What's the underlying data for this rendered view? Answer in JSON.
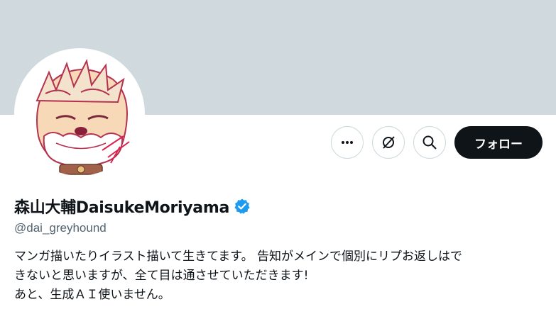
{
  "profile": {
    "display_name": "森山大輔DaisukeMoriyama",
    "handle": "@dai_greyhound",
    "verified": true,
    "bio_lines": [
      "マンガ描いたりイラスト描いて生きてます。 告知がメインで個別にリプお返しはで",
      "きないと思いますが、全て目は通させていただきます!",
      "あと、生成ＡＩ使いません。"
    ]
  },
  "actions": {
    "more_icon": "more-horizontal-icon",
    "grok_icon": "grok-icon",
    "search_icon": "search-icon",
    "follow_label": "フォロー"
  },
  "colors": {
    "banner": "#cfd9de",
    "follow_button": "#0f1419",
    "verified_badge": "#1d9bf0",
    "secondary_text": "#536471"
  }
}
